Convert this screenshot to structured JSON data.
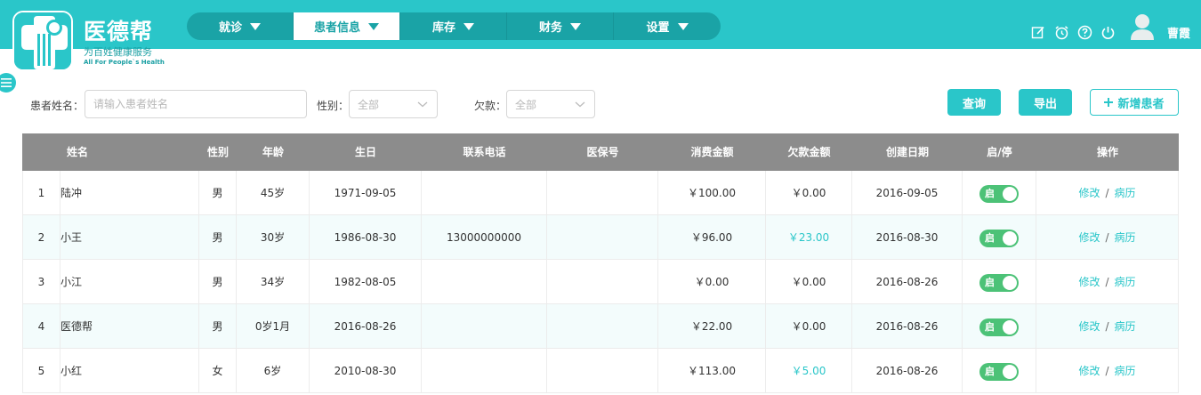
{
  "app": {
    "name": "医德帮",
    "tagline": "为百姓健康服务",
    "slogan": "All For People`s Health"
  },
  "nav": [
    {
      "label": "就诊",
      "active": false
    },
    {
      "label": "患者信息",
      "active": true
    },
    {
      "label": "库存",
      "active": false
    },
    {
      "label": "财务",
      "active": false
    },
    {
      "label": "设置",
      "active": false
    }
  ],
  "header_icons": [
    "edit-icon",
    "alarm-icon",
    "help-icon",
    "power-icon"
  ],
  "user": {
    "name": "曹霞"
  },
  "filters": {
    "name_label": "患者姓名：",
    "name_placeholder": "请输入患者姓名",
    "name_value": "",
    "gender_label": "性别：",
    "gender_value": "全部",
    "debt_label": "欠款：",
    "debt_value": "全部"
  },
  "actions": {
    "query": "查询",
    "export": "导出",
    "add_patient": "新增患者"
  },
  "table": {
    "columns": [
      "姓名",
      "性别",
      "年龄",
      "生日",
      "联系电话",
      "医保号",
      "消费金额",
      "欠款金额",
      "创建日期",
      "启/停",
      "操作"
    ],
    "rows": [
      {
        "index": "1",
        "name": "陆冲",
        "gender": "男",
        "age": "45岁",
        "birthday": "1971-09-05",
        "phone": "",
        "insurance": "",
        "spent": "￥100.00",
        "debt": "￥0.00",
        "debt_highlight": false,
        "created": "2016-09-05",
        "enabled_label": "启",
        "edit": "修改",
        "record": "病历"
      },
      {
        "index": "2",
        "name": "小王",
        "gender": "男",
        "age": "30岁",
        "birthday": "1986-08-30",
        "phone": "13000000000",
        "insurance": "",
        "spent": "￥96.00",
        "debt": "￥23.00",
        "debt_highlight": true,
        "created": "2016-08-30",
        "enabled_label": "启",
        "edit": "修改",
        "record": "病历"
      },
      {
        "index": "3",
        "name": "小江",
        "gender": "男",
        "age": "34岁",
        "birthday": "1982-08-05",
        "phone": "",
        "insurance": "",
        "spent": "￥0.00",
        "debt": "￥0.00",
        "debt_highlight": false,
        "created": "2016-08-26",
        "enabled_label": "启",
        "edit": "修改",
        "record": "病历"
      },
      {
        "index": "4",
        "name": "医德帮",
        "gender": "男",
        "age": "0岁1月",
        "birthday": "2016-08-26",
        "phone": "",
        "insurance": "",
        "spent": "￥22.00",
        "debt": "￥0.00",
        "debt_highlight": false,
        "created": "2016-08-26",
        "enabled_label": "启",
        "edit": "修改",
        "record": "病历"
      },
      {
        "index": "5",
        "name": "小红",
        "gender": "女",
        "age": "6岁",
        "birthday": "2010-08-30",
        "phone": "",
        "insurance": "",
        "spent": "￥113.00",
        "debt": "￥5.00",
        "debt_highlight": true,
        "created": "2016-08-26",
        "enabled_label": "启",
        "edit": "修改",
        "record": "病历"
      }
    ],
    "op_separator": "/"
  },
  "colors": {
    "brand": "#2ac6c9",
    "brand_dark": "#1aa3a6",
    "header_gray": "#8c8c8c",
    "toggle_green": "#4cc277"
  }
}
